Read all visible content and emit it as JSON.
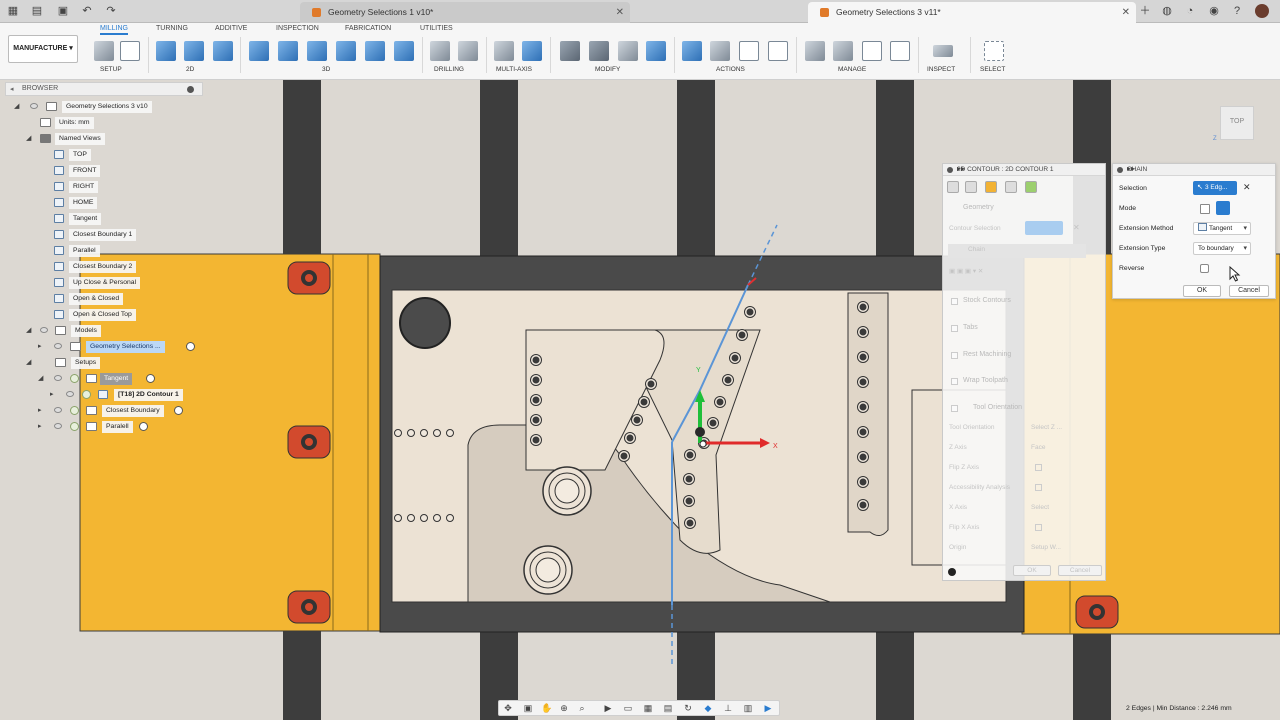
{
  "tabs": [
    {
      "title": "Geometry Selections 1 v10*",
      "active": false
    },
    {
      "title": "Geometry Selections 3 v11*",
      "active": true
    }
  ],
  "ribbon": {
    "workspace": "MANUFACTURE",
    "tabs": [
      "MILLING",
      "TURNING",
      "ADDITIVE",
      "INSPECTION",
      "FABRICATION",
      "UTILITIES"
    ],
    "groups": {
      "setup": "SETUP",
      "g2d": "2D",
      "g3d": "3D",
      "drilling": "DRILLING",
      "multiaxis": "MULTI-AXIS",
      "modify": "MODIFY",
      "actions": "ACTIONS",
      "manage": "MANAGE",
      "inspect": "INSPECT",
      "select": "SELECT"
    }
  },
  "browser": {
    "title": "BROWSER",
    "root": "Geometry Selections 3 v10",
    "units": "Units: mm",
    "named_views_label": "Named Views",
    "named_views": [
      "TOP",
      "FRONT",
      "RIGHT",
      "HOME",
      "Tangent",
      "Closest Boundary 1",
      "Parallel",
      "Closest Boundary 2",
      "Up Close & Personal",
      "Open & Closed",
      "Open & Closed Top"
    ],
    "models_label": "Models",
    "model": "Geometry Selections ...",
    "setups_label": "Setups",
    "setup_tangent": "Tangent",
    "operation": "[T18] 2D Contour 1",
    "setup_closest": "Closest Boundary",
    "setup_parallel": "Paralell"
  },
  "contour_panel": {
    "title": "2D CONTOUR : 2D CONTOUR 1",
    "geometry": "Geometry",
    "contour_selection": "Contour Selection",
    "chain": "Chain",
    "stock_contours": "Stock Contours",
    "tabs": "Tabs",
    "rest_machining": "Rest Machining",
    "wrap_toolpath": "Wrap Toolpath",
    "tool_orientation_section": "Tool Orientation",
    "tool_orientation": "Tool Orientation",
    "tool_orientation_value": "Select Z ...",
    "z_axis": "Z Axis",
    "z_axis_value": "Face",
    "flip_z": "Flip Z Axis",
    "accessibility": "Accessibility Analysis",
    "x_axis": "X Axis",
    "x_axis_value": "Select",
    "flip_x": "Flip X Axis",
    "origin": "Origin",
    "origin_value": "Setup W...",
    "ok": "OK",
    "cancel": "Cancel"
  },
  "chain_panel": {
    "title": "CHAIN",
    "selection_label": "Selection",
    "selection_value": "3 Edg...",
    "mode_label": "Mode",
    "ext_method_label": "Extension Method",
    "ext_method_value": "Tangent",
    "ext_type_label": "Extension Type",
    "ext_type_value": "To boundary",
    "reverse_label": "Reverse",
    "reverse_checked": false,
    "ok": "OK",
    "cancel": "Cancel"
  },
  "viewcube": {
    "face": "TOP",
    "axis": "Z"
  },
  "triad": {
    "x": "X",
    "y": "Y"
  },
  "status": "2 Edges | Min Distance : 2.246 mm",
  "colors": {
    "accent": "#2a7ccf",
    "vise": "#f2b233",
    "part": "#ebe1d3",
    "rail": "#3f3f3f"
  }
}
